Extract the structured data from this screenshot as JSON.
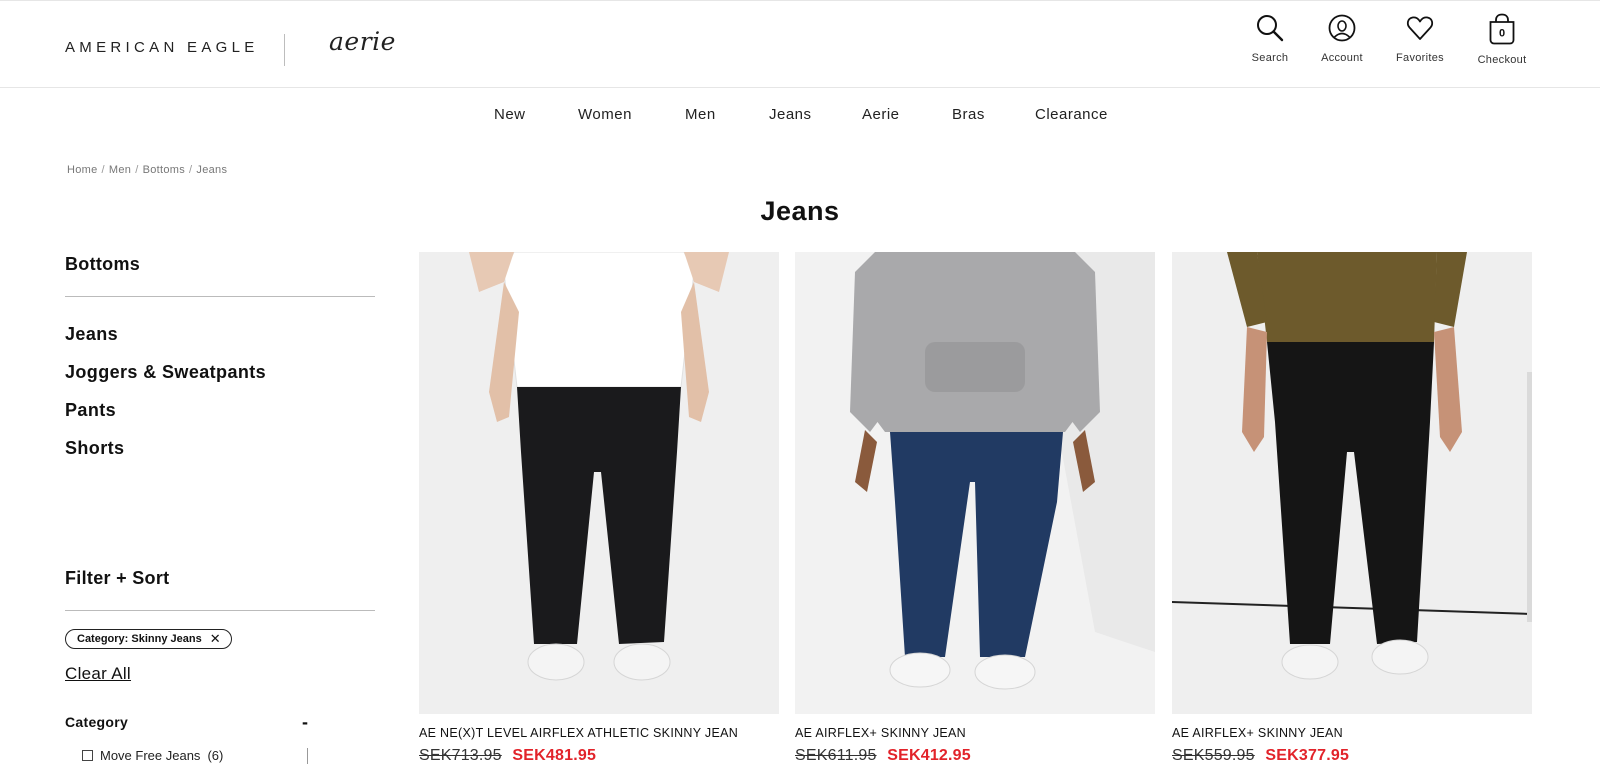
{
  "header": {
    "brand_primary": "AMERICAN EAGLE",
    "brand_secondary": "aerie",
    "utilities": [
      {
        "label": "Search",
        "icon": "search-icon"
      },
      {
        "label": "Account",
        "icon": "account-icon"
      },
      {
        "label": "Favorites",
        "icon": "heart-icon"
      },
      {
        "label": "Checkout",
        "icon": "bag-icon",
        "badge": "0"
      }
    ]
  },
  "nav": {
    "items": [
      "New",
      "Women",
      "Men",
      "Jeans",
      "Aerie",
      "Bras",
      "Clearance"
    ]
  },
  "breadcrumb": [
    "Home",
    "Men",
    "Bottoms",
    "Jeans"
  ],
  "page_title": "Jeans",
  "sidebar": {
    "section_title": "Bottoms",
    "categories": [
      "Jeans",
      "Joggers & Sweatpants",
      "Pants",
      "Shorts"
    ],
    "filter_title": "Filter + Sort",
    "active_filter": "Category: Skinny Jeans",
    "clear_all": "Clear All",
    "category_facet": {
      "title": "Category",
      "toggle": "-",
      "options": [
        {
          "label": "Move Free Jeans",
          "count": "(6)"
        }
      ]
    }
  },
  "products": [
    {
      "name": "AE NE(X)T LEVEL AIRFLEX ATHLETIC SKINNY JEAN",
      "old_price": "SEK713.95",
      "sale_price": "SEK481.95",
      "top_color": "#ffffff",
      "jean_color": "#1a1a1c"
    },
    {
      "name": "AE AIRFLEX+ SKINNY JEAN",
      "old_price": "SEK611.95",
      "sale_price": "SEK412.95",
      "top_color": "#a9a9ab",
      "jean_color": "#213a63"
    },
    {
      "name": "AE AIRFLEX+ SKINNY JEAN",
      "old_price": "SEK559.95",
      "sale_price": "SEK377.95",
      "top_color": "#6d5a2c",
      "jean_color": "#151515"
    }
  ],
  "colors": {
    "sale": "#e2232a",
    "text": "#111111"
  }
}
